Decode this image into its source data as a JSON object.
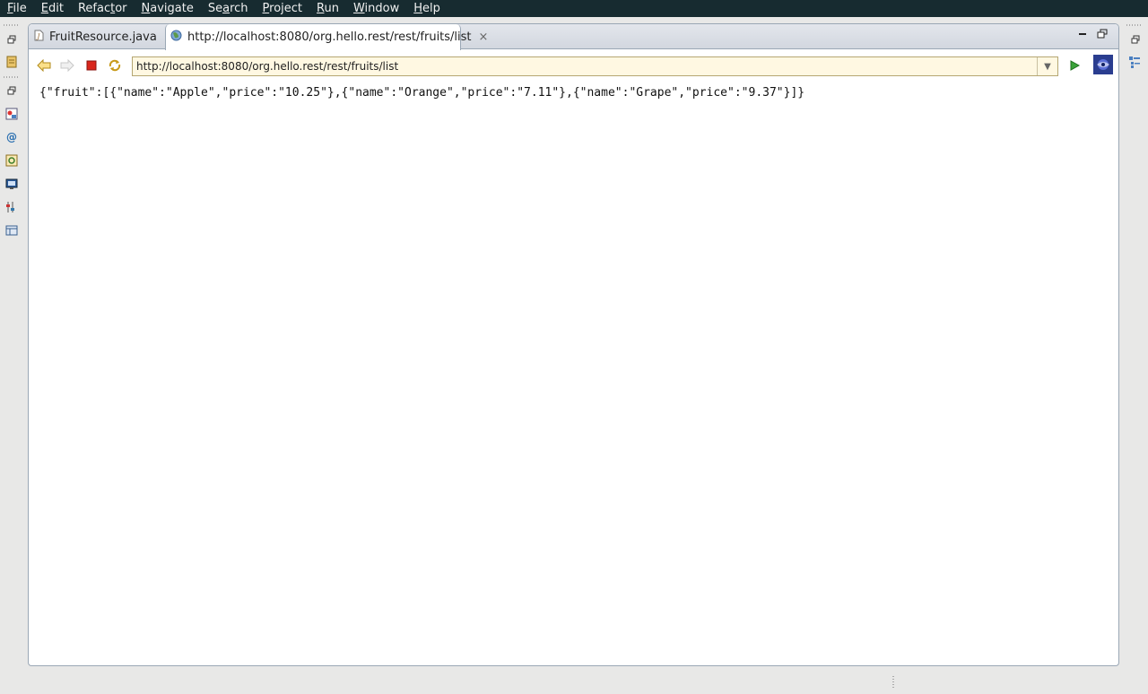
{
  "menu": {
    "items": [
      {
        "pre": "",
        "u": "F",
        "post": "ile"
      },
      {
        "pre": "",
        "u": "E",
        "post": "dit"
      },
      {
        "pre": "Refac",
        "u": "t",
        "post": "or"
      },
      {
        "pre": "",
        "u": "N",
        "post": "avigate"
      },
      {
        "pre": "Se",
        "u": "a",
        "post": "rch"
      },
      {
        "pre": "",
        "u": "P",
        "post": "roject"
      },
      {
        "pre": "",
        "u": "R",
        "post": "un"
      },
      {
        "pre": "",
        "u": "W",
        "post": "indow"
      },
      {
        "pre": "",
        "u": "H",
        "post": "elp"
      }
    ]
  },
  "editor": {
    "tabs": {
      "java": {
        "label": "FruitResource.java",
        "icon": "java-file-icon"
      },
      "browser": {
        "label": "http://localhost:8080/org.hello.rest/rest/fruits/list",
        "icon": "globe-icon",
        "close": "×"
      }
    }
  },
  "browser": {
    "url": "http://localhost:8080/org.hello.rest/rest/fruits/list",
    "dropdown_glyph": "▼"
  },
  "page": {
    "body": "{\"fruit\":[{\"name\":\"Apple\",\"price\":\"10.25\"},{\"name\":\"Orange\",\"price\":\"7.11\"},{\"name\":\"Grape\",\"price\":\"9.37\"}]}"
  },
  "colors": {
    "menubar": "#172b30",
    "url_bg": "#fff8e2",
    "editor_border": "#9aa7b5"
  }
}
